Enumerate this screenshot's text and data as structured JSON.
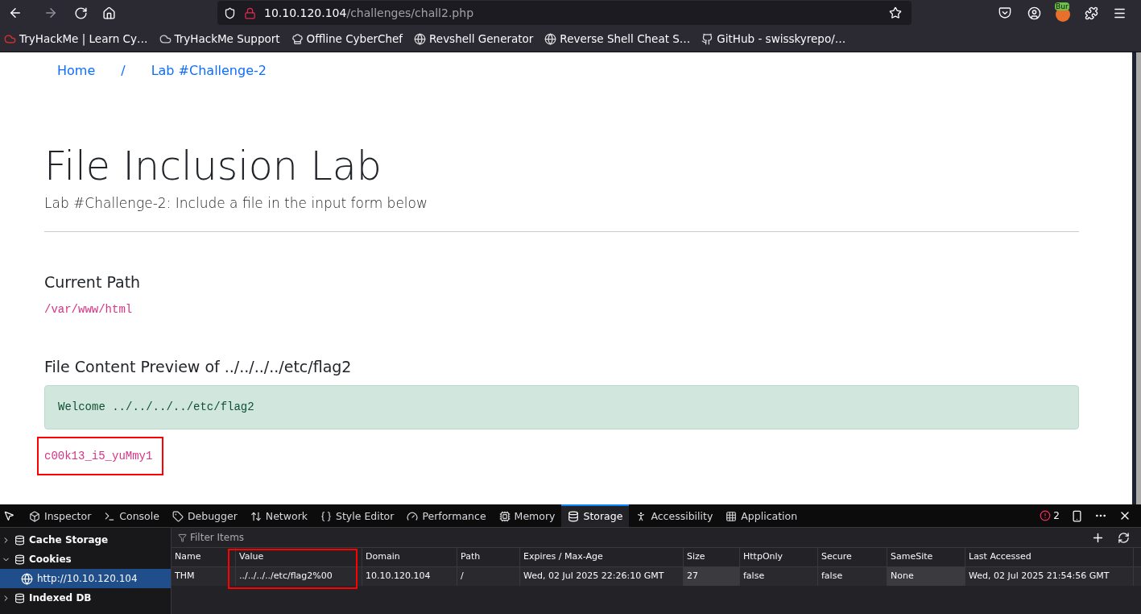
{
  "toolbar": {
    "url_host": "10.10.120.104",
    "url_path": "/challenges/chall2.php",
    "extension_badge": "Bur"
  },
  "bookmarks": [
    {
      "label": "TryHackMe | Learn Cy…",
      "kind": "thm"
    },
    {
      "label": "TryHackMe Support",
      "kind": "cloud"
    },
    {
      "label": "Offline CyberChef",
      "kind": "chef"
    },
    {
      "label": "Revshell Generator",
      "kind": "globe"
    },
    {
      "label": "Reverse Shell Cheat S…",
      "kind": "globe"
    },
    {
      "label": "GitHub - swisskyrepo/…",
      "kind": "github"
    }
  ],
  "breadcrumb": [
    {
      "label": "Home"
    },
    {
      "label": "/"
    },
    {
      "label": "Lab #Challenge-2"
    }
  ],
  "page": {
    "title": "File Inclusion Lab",
    "subtitle": "Lab #Challenge-2: Include a file in the input form below",
    "path_heading": "Current Path",
    "path": "/var/www/html",
    "preview_heading": "File Content Preview of ../../../../etc/flag2",
    "preview_text": "Welcome ../../../../etc/flag2",
    "flag": "c00k13_i5_yuMmy1"
  },
  "devtools": {
    "tabs": [
      {
        "label": "Inspector",
        "selected": false
      },
      {
        "label": "Console",
        "selected": false
      },
      {
        "label": "Debugger",
        "selected": false
      },
      {
        "label": "Network",
        "selected": false
      },
      {
        "label": "Style Editor",
        "selected": false
      },
      {
        "label": "Performance",
        "selected": false
      },
      {
        "label": "Memory",
        "selected": false
      },
      {
        "label": "Storage",
        "selected": true
      },
      {
        "label": "Accessibility",
        "selected": false
      },
      {
        "label": "Application",
        "selected": false
      }
    ],
    "error_count": "2",
    "tree": [
      {
        "label": "Cache Storage",
        "expanded": false
      },
      {
        "label": "Cookies",
        "expanded": true,
        "children": [
          {
            "label": "http://10.10.120.104",
            "selected": true
          }
        ]
      },
      {
        "label": "Indexed DB",
        "expanded": false
      }
    ],
    "filter_placeholder": "Filter Items",
    "table": {
      "columns": [
        "Name",
        "Value",
        "Domain",
        "Path",
        "Expires / Max-Age",
        "Size",
        "HttpOnly",
        "Secure",
        "SameSite",
        "Last Accessed"
      ],
      "rows": [
        [
          "THM",
          "../../../../etc/flag2%00",
          "10.10.120.104",
          "/",
          "Wed, 02 Jul 2025 22:26:10 GMT",
          "27",
          "false",
          "false",
          "None",
          "Wed, 02 Jul 2025 21:54:56 GMT"
        ]
      ]
    }
  }
}
